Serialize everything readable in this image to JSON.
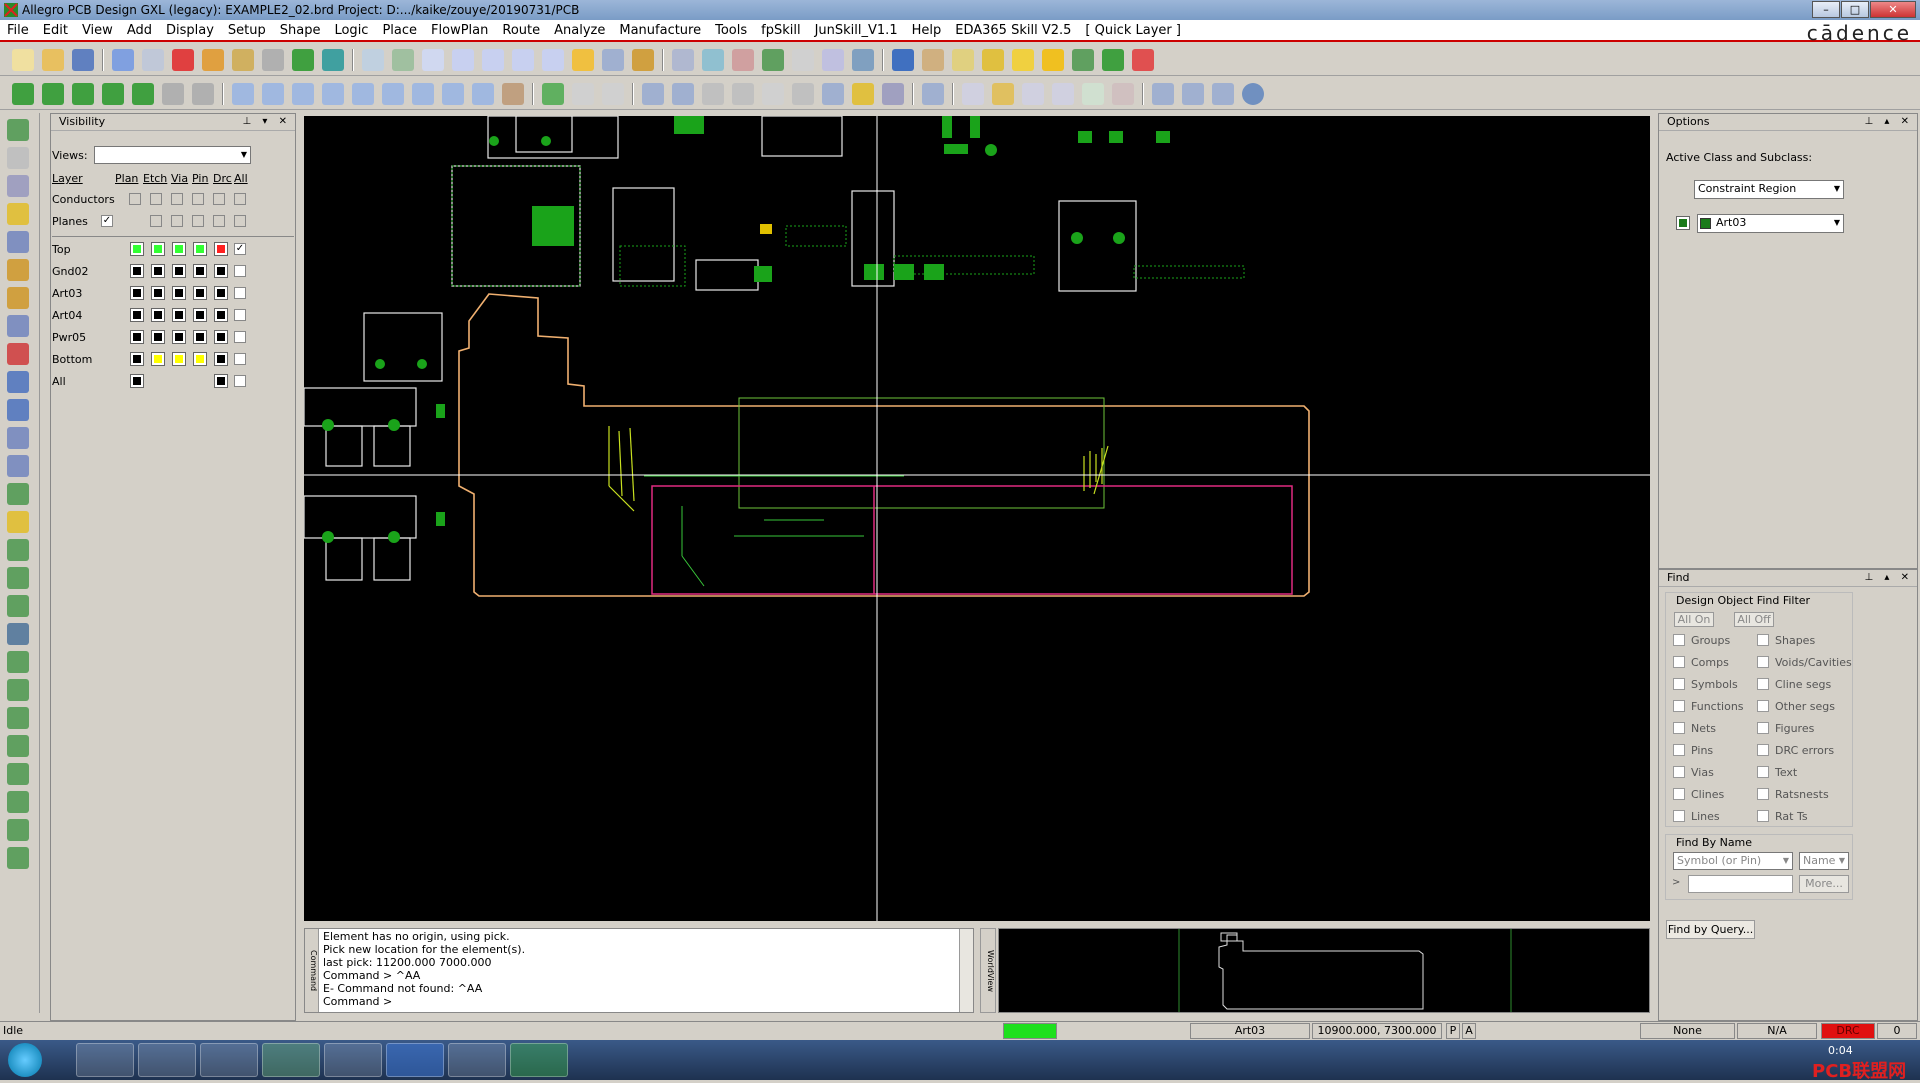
{
  "window": {
    "title": "Allegro PCB Design GXL (legacy): EXAMPLE2_02.brd  Project: D:.../kaike/zouye/20190731/PCB"
  },
  "menu": [
    "File",
    "Edit",
    "View",
    "Add",
    "Display",
    "Setup",
    "Shape",
    "Logic",
    "Place",
    "FlowPlan",
    "Route",
    "Analyze",
    "Manufacture",
    "Tools",
    "fpSkill",
    "JunSkill_V1.1",
    "Help",
    "EDA365 Skill V2.5",
    "[ Quick Layer ]"
  ],
  "brand": "cādence",
  "visibility": {
    "title": "Visibility",
    "views_label": "Views:",
    "columns": [
      "Layer",
      "Plan",
      "Etch",
      "Via",
      "Pin",
      "Drc",
      "All"
    ],
    "group_rows": [
      "Conductors",
      "Planes"
    ],
    "layers": [
      "Top",
      "Gnd02",
      "Art03",
      "Art04",
      "Pwr05",
      "Bottom",
      "All"
    ]
  },
  "options": {
    "title": "Options",
    "active_class_label": "Active Class and Subclass:",
    "class_value": "Constraint Region",
    "subclass_value": "Art03"
  },
  "find": {
    "title": "Find",
    "filter_label": "Design Object Find Filter",
    "all_on": "All On",
    "all_off": "All Off",
    "items_left": [
      "Groups",
      "Comps",
      "Symbols",
      "Functions",
      "Nets",
      "Pins",
      "Vias",
      "Clines",
      "Lines"
    ],
    "items_right": [
      "Shapes",
      "Voids/Cavities",
      "Cline segs",
      "Other segs",
      "Figures",
      "DRC errors",
      "Text",
      "Ratsnests",
      "Rat Ts"
    ],
    "by_name_label": "Find By Name",
    "by_name_type": "Symbol (or Pin)",
    "by_name_mode": "Name",
    "more_button": "More...",
    "query_button": "Find by Query..."
  },
  "command": {
    "tab_label": "Command",
    "lines": [
      "Element has no origin, using pick.",
      "Pick new location for the element(s).",
      "last pick:  11200.000 7000.000",
      "Command > ^AA",
      "E- Command not found: ^AA",
      "Command >"
    ]
  },
  "worldview": {
    "tab_label": "WorldView"
  },
  "status": {
    "state": "Idle",
    "layer": "Art03",
    "coords": "10900.000, 7300.000",
    "p": "P",
    "a": "A",
    "mode": "None",
    "na": "N/A",
    "drc": "DRC",
    "count": "0"
  },
  "taskbar": {
    "clock": "0:04",
    "watermark": "PCB联盟网"
  }
}
